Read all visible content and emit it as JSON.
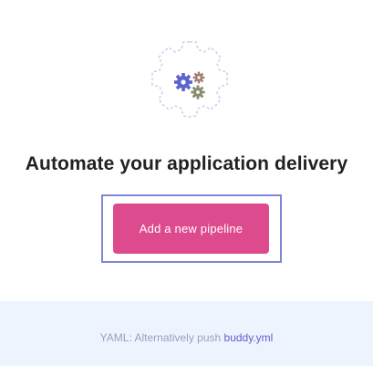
{
  "hero": {
    "icon": "gears-in-cog-icon",
    "headline": "Automate your application delivery"
  },
  "actions": {
    "add_pipeline_label": "Add a new pipeline"
  },
  "footer": {
    "prefix": "YAML: Alternatively push ",
    "link_text": "buddy.yml"
  },
  "colors": {
    "primary_button": "#de4a8e",
    "focus_ring": "#7f86d8",
    "footer_bg": "#eef4fd",
    "footer_text": "#9e9cc4",
    "link": "#6a59cc",
    "gear_blue": "#5b64cc",
    "gear_olive": "#8a8a6e",
    "gear_brown": "#a07e72",
    "outline_cog": "#c8d4f0"
  }
}
